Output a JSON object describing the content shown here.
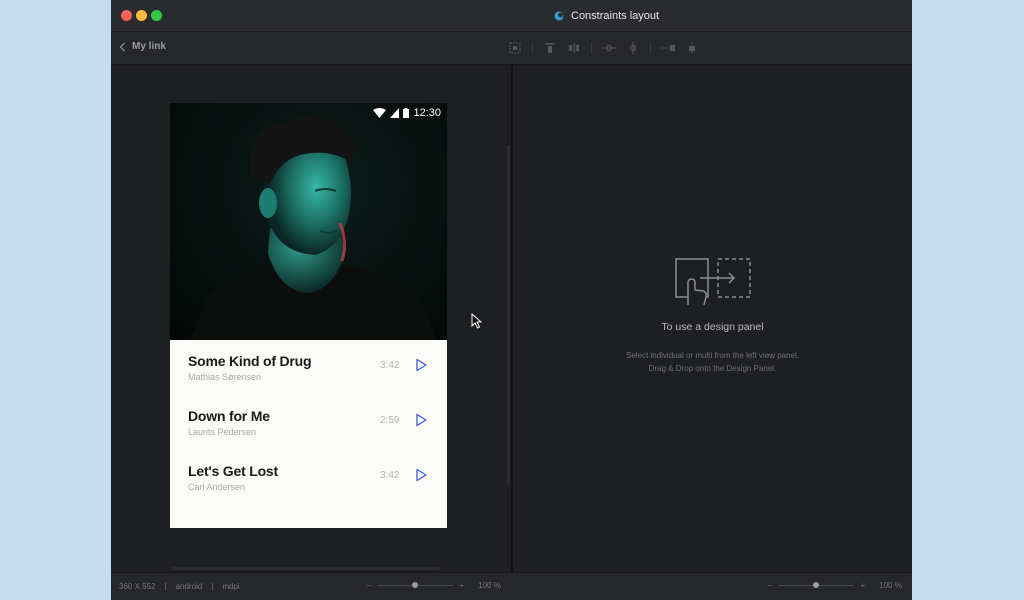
{
  "window": {
    "title": "Constraints layout"
  },
  "toolbar": {
    "back_label": "My link"
  },
  "phone": {
    "status_time": "12:30",
    "songs": [
      {
        "title": "Some Kind of Drug",
        "artist": "Mathias Sørensen",
        "duration": "3:42"
      },
      {
        "title": "Down for Me",
        "artist": "Laurits Pedersen",
        "duration": "2:59"
      },
      {
        "title": "Let's Get Lost",
        "artist": "Carl Andersen",
        "duration": "3:42"
      }
    ]
  },
  "design_panel": {
    "title": "To use a design panel",
    "line1": "Select individual or multi from the left view panel.",
    "line2": "Drag & Drop onto the Design Panel."
  },
  "statusbar": {
    "dimensions": "360 X 552",
    "platform": "android",
    "density": "mdpi",
    "left_zoom": "100 %",
    "right_zoom": "100 %",
    "minus": "–",
    "plus": "+"
  },
  "colors": {
    "accent": "#3a5bd9",
    "dark_bg": "#1e1f22",
    "card_bg": "#fbfbf8"
  }
}
